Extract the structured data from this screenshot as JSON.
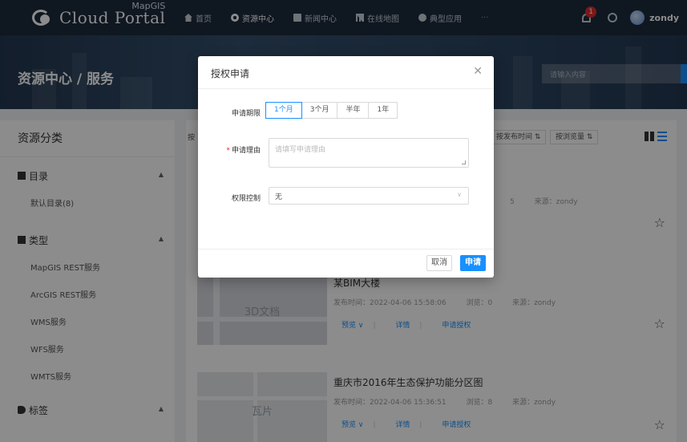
{
  "nav": {
    "brand_small": "MapGIS",
    "brand": "Cloud Portal",
    "items": [
      {
        "label": "首页",
        "icon": "home-icon"
      },
      {
        "label": "资源中心",
        "icon": "gear-icon"
      },
      {
        "label": "新闻中心",
        "icon": "news-icon"
      },
      {
        "label": "在线地图",
        "icon": "map-icon"
      },
      {
        "label": "典型应用",
        "icon": "app-icon"
      }
    ],
    "more": "···",
    "notification_count": "1",
    "username": "zondy"
  },
  "banner": {
    "title": "资源中心 / 服务",
    "search_placeholder": "请输入内容"
  },
  "sidebar": {
    "title": "资源分类",
    "groups": [
      {
        "label": "目录",
        "items": [
          "默认目录(8)"
        ]
      },
      {
        "label": "类型",
        "items": [
          "MapGIS REST服务",
          "ArcGIS REST服务",
          "WMS服务",
          "WFS服务",
          "WMTS服务"
        ]
      },
      {
        "label": "标签",
        "items": []
      }
    ]
  },
  "main": {
    "sort_label": "按",
    "sort_publish": "按发布时间 ⇅",
    "sort_views": "按浏览量 ⇅",
    "cards": [
      {
        "title": "",
        "publish": "",
        "views": "5",
        "source": "来源：zondy",
        "thumb_label": ""
      },
      {
        "title": "某BIM大楼",
        "publish": "发布时间：2022-04-06 15:58:06",
        "views": "浏览：0",
        "source": "来源：zondy",
        "thumb_label": "3D文档",
        "actions": [
          "预览 ∨",
          "详情",
          "申请授权"
        ]
      },
      {
        "title": "重庆市2016年生态保护功能分区图",
        "publish": "发布时间：2022-04-06 15:36:51",
        "views": "浏览：8",
        "source": "来源：zondy",
        "thumb_label": "瓦片",
        "actions": [
          "预览 ∨",
          "详情",
          "申请授权"
        ]
      }
    ]
  },
  "modal": {
    "title": "授权申请",
    "period_label": "申请期限",
    "period_options": [
      "1个月",
      "3个月",
      "半年",
      "1年"
    ],
    "period_selected": "1个月",
    "reason_label": "申请理由",
    "reason_placeholder": "请填写申请理由",
    "control_label": "权限控制",
    "control_value": "无",
    "cancel": "取消",
    "submit": "申请"
  },
  "colors": {
    "accent": "#1890ff",
    "nav_bg": "#1d2a3d",
    "badge": "#e02d2d"
  }
}
